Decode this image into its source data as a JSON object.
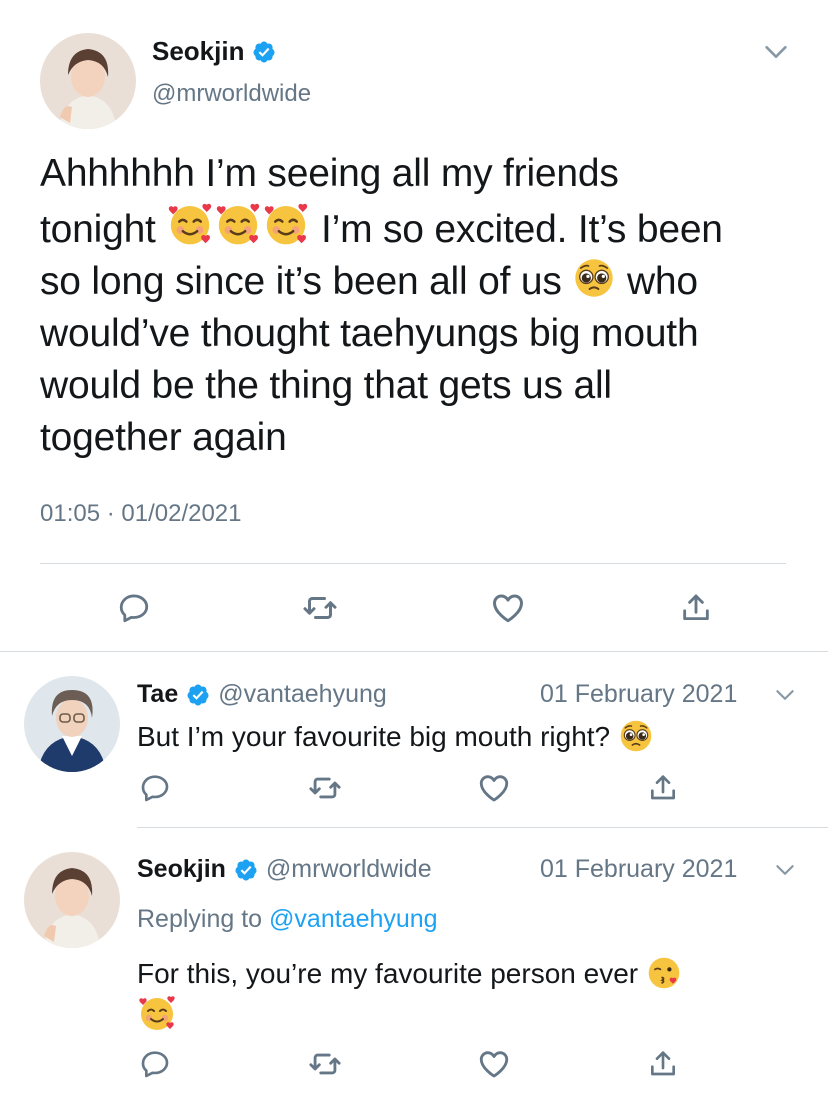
{
  "main_tweet": {
    "author_name": "Seokjin",
    "author_handle": "@mrworldwide",
    "verified": true,
    "text_lines": [
      "Ahhhhhh I’m seeing all my friends",
      "I’m so excited. It’s been",
      "so long since it’s been all of us",
      "who",
      "would’ve thought taehyungs big mouth",
      "would be the thing that gets us all",
      "together again"
    ],
    "text_line_2_prefix": "tonight",
    "timestamp": "01:05 · 01/02/2021",
    "icons": [
      "reply-icon",
      "retweet-icon",
      "like-icon",
      "share-icon"
    ]
  },
  "replies": [
    {
      "author_name": "Tae",
      "author_handle": "@vantaehyung",
      "verified": true,
      "date": "01 February 2021",
      "text": "But I’m your favourite big mouth right?"
    },
    {
      "author_name": "Seokjin",
      "author_handle": "@mrworldwide",
      "verified": true,
      "date": "01 February 2021",
      "replying_label": "Replying to",
      "replying_to": "@vantaehyung",
      "text": "For this, you’re my favourite person ever"
    }
  ],
  "colors": {
    "verified_blue": "#1da1f2",
    "secondary_text": "#657786",
    "icon_gray": "#657786",
    "divider": "#d6dbdf"
  }
}
